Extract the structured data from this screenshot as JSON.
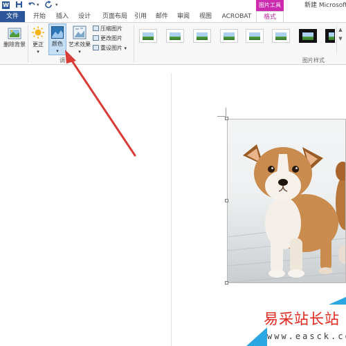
{
  "quick_access": {
    "app_icon": "word-icon",
    "save_icon": "save-icon",
    "undo_icon": "undo-icon",
    "redo_icon": "redo-icon"
  },
  "title_bar": {
    "context_tab_group": "图片工具",
    "document_title": "新建 Microsoft"
  },
  "tabs": [
    {
      "label": "文件"
    },
    {
      "label": "开始"
    },
    {
      "label": "插入"
    },
    {
      "label": "设计"
    },
    {
      "label": "页面布局"
    },
    {
      "label": "引用"
    },
    {
      "label": "邮件"
    },
    {
      "label": "审阅"
    },
    {
      "label": "视图"
    },
    {
      "label": "ACROBAT"
    },
    {
      "label": "格式"
    }
  ],
  "ribbon": {
    "adjust_group": {
      "remove_background": "删除背景",
      "corrections": "更正",
      "color": "颜色",
      "artistic_effects": "艺术效果",
      "compress": "压缩图片",
      "change": "更改图片",
      "reset": "重设图片",
      "label": "调"
    },
    "style_group": {
      "label": "图片样式",
      "scroll_up": "▲",
      "scroll_down": "▼"
    }
  },
  "watermark": {
    "text": "易采站长站",
    "url": "www.easck.com"
  },
  "colors": {
    "accent_blue": "#2b579a",
    "picture_tools": "#cc2bb0",
    "arrow_red": "#d93b36",
    "watermark_red": "#e4251b"
  }
}
